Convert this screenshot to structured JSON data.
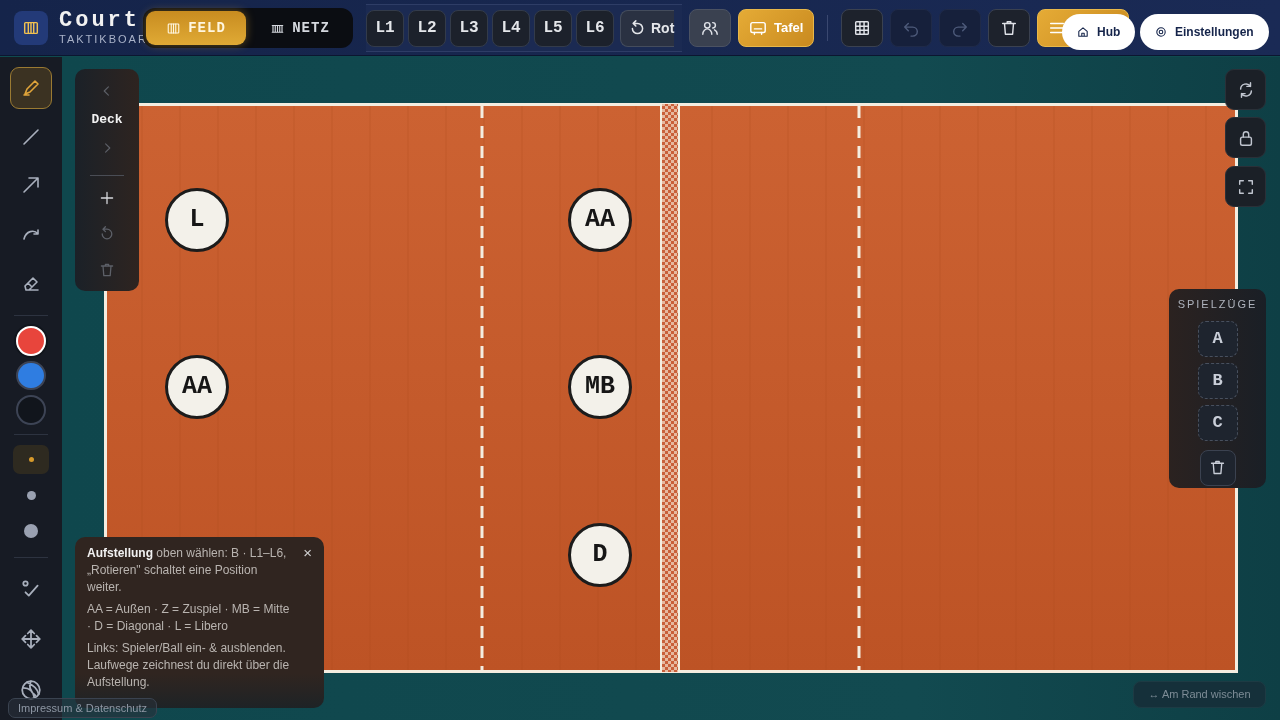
{
  "app": {
    "title": "Court",
    "subtitle": "TAKTIKBOAR"
  },
  "view_toggle": [
    {
      "kind": "court",
      "label": "FELD",
      "selected": true
    },
    {
      "kind": "net",
      "label": "NETZ",
      "selected": false
    }
  ],
  "lineups": [
    {
      "label": "L1"
    },
    {
      "label": "L2"
    },
    {
      "label": "L3"
    },
    {
      "label": "L4"
    },
    {
      "label": "L5"
    },
    {
      "label": "L6"
    }
  ],
  "rotate_button": {
    "label": "Rot"
  },
  "toolbar": [
    {
      "kind": "players",
      "active": false,
      "disabled": false
    },
    {
      "kind": "board",
      "label": "Tafel",
      "active": true,
      "disabled": false
    },
    {
      "kind": "grid",
      "active": false,
      "disabled": false
    },
    {
      "kind": "undo",
      "active": false,
      "disabled": true
    },
    {
      "kind": "redo",
      "active": false,
      "disabled": true
    },
    {
      "kind": "trash",
      "active": false,
      "disabled": false
    },
    {
      "kind": "menu",
      "active": true,
      "disabled": false
    }
  ],
  "nav_pills": [
    {
      "kind": "home",
      "label": "Hub"
    },
    {
      "kind": "settings",
      "label": "Einstellungen"
    }
  ],
  "tools": [
    {
      "kind": "pen",
      "selected": true
    },
    {
      "kind": "line",
      "selected": false
    },
    {
      "kind": "arrow",
      "selected": false
    },
    {
      "kind": "curve",
      "selected": false
    },
    {
      "kind": "eraser",
      "selected": false
    }
  ],
  "colors": [
    {
      "color": "#e8453c",
      "selected": true
    },
    {
      "color": "#2f7de1",
      "selected": false
    },
    {
      "color": "#11151c",
      "selected": false
    }
  ],
  "sizes": [
    {
      "kind": "small",
      "selected": true
    },
    {
      "kind": "medium",
      "selected": false
    },
    {
      "kind": "large",
      "selected": false
    }
  ],
  "extra_tools": [
    {
      "kind": "check"
    },
    {
      "kind": "move"
    },
    {
      "kind": "ball"
    }
  ],
  "deck": {
    "title": "Deck",
    "controls": [
      {
        "kind": "prev",
        "disabled": true
      },
      {
        "kind": "next",
        "disabled": true
      },
      {
        "kind": "add",
        "disabled": false
      },
      {
        "kind": "reset",
        "disabled": true
      },
      {
        "kind": "delete",
        "disabled": true
      }
    ]
  },
  "player_rows": [
    {
      "back": {
        "label": "L"
      },
      "front": {
        "label": "AA"
      }
    },
    {
      "back": {
        "label": "AA"
      },
      "front": {
        "label": "MB"
      }
    },
    {
      "front": {
        "label": "D"
      }
    }
  ],
  "view_controls": [
    {
      "kind": "rotate"
    },
    {
      "kind": "lock"
    },
    {
      "kind": "fullscreen"
    }
  ],
  "plays": {
    "title": "SPIELZÜGE",
    "slots": [
      {
        "label": "A"
      },
      {
        "label": "B"
      },
      {
        "label": "C"
      }
    ]
  },
  "hint": {
    "paragraphs": [
      "**Aufstellung** oben wählen: B · L1–L6, „Rotieren\" schaltet eine Position weiter.",
      "AA = Außen · Z = Zuspiel · MB = Mitte · D = Diagonal · L = Libero",
      "Links: Spieler/Ball ein- & ausblenden. Laufwege zeichnest du direkt über die Aufstellung."
    ],
    "close": "×"
  },
  "footer_link": "Impressum & Datenschutz",
  "swipe_hint": "↔ Am Rand wischen"
}
